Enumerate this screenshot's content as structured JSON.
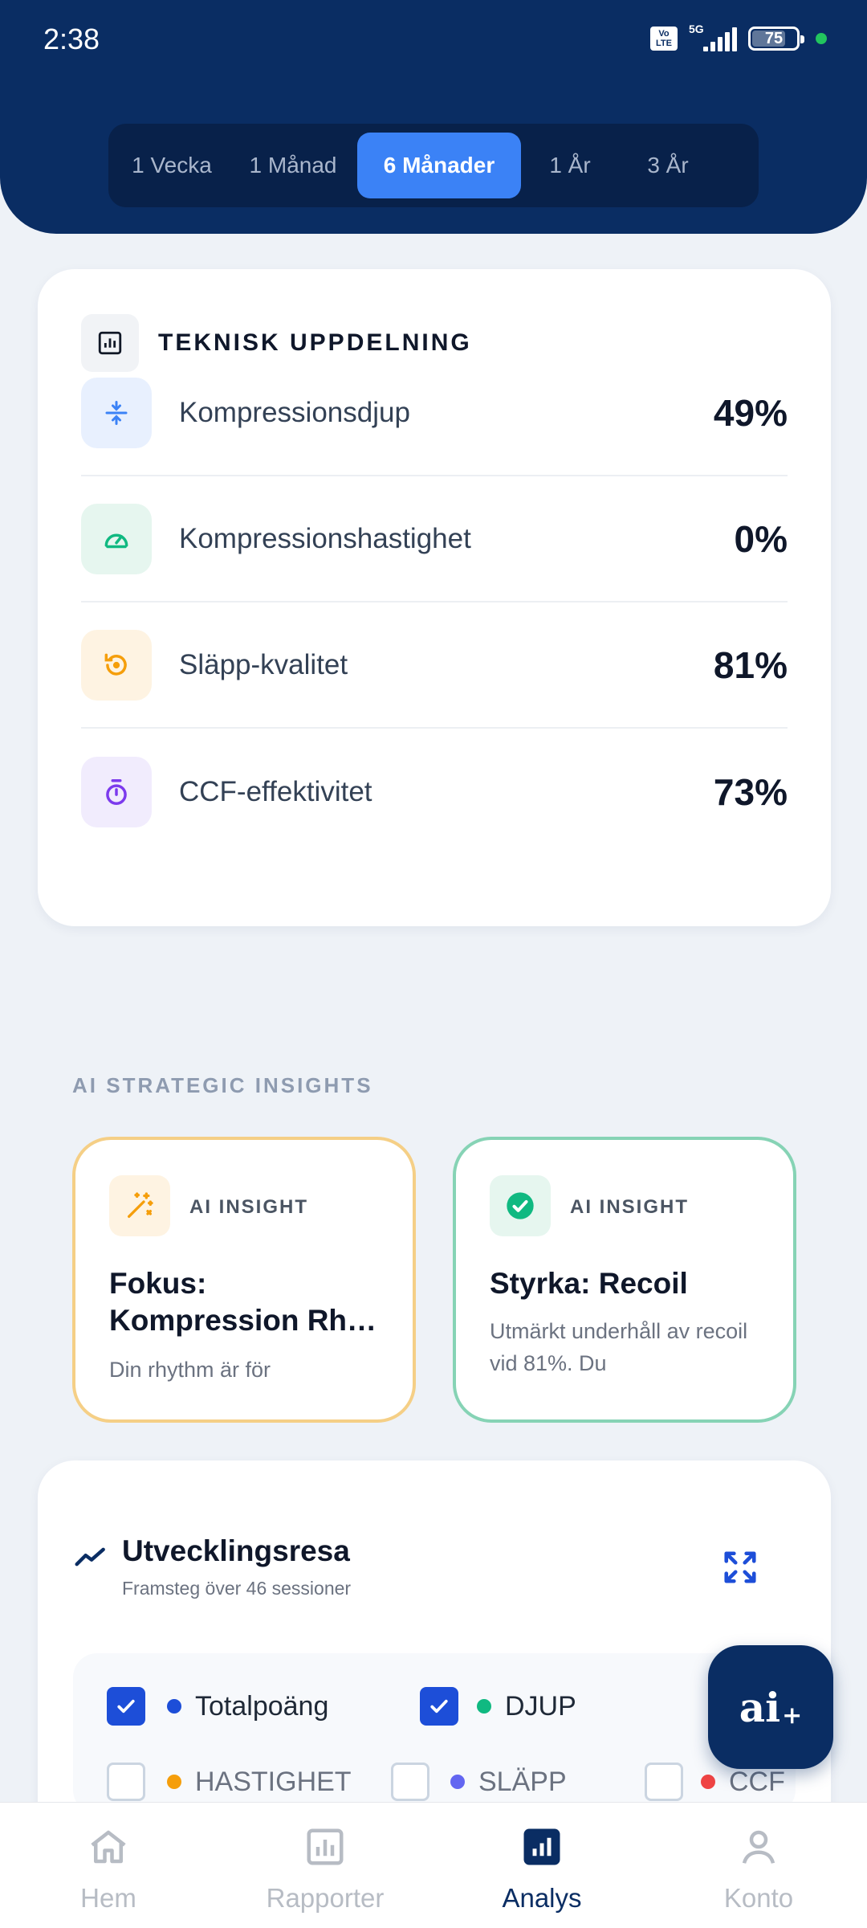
{
  "status_bar": {
    "time": "2:38",
    "volte": "Vo LTE",
    "network": "5G",
    "battery": "75"
  },
  "range_tabs": [
    {
      "label": "1 Vecka",
      "active": false
    },
    {
      "label": "1 Månad",
      "active": false
    },
    {
      "label": "6 Månader",
      "active": true
    },
    {
      "label": "1 År",
      "active": false
    },
    {
      "label": "3 År",
      "active": false
    }
  ],
  "technical": {
    "title": "TEKNISK UPPDELNING",
    "metrics": [
      {
        "label": "Kompressionsdjup",
        "value": "49%",
        "icon": "compress-icon"
      },
      {
        "label": "Kompressionshastighet",
        "value": "0%",
        "icon": "speedometer-icon"
      },
      {
        "label": "Släpp-kvalitet",
        "value": "81%",
        "icon": "recoil-icon"
      },
      {
        "label": "CCF-effektivitet",
        "value": "73%",
        "icon": "timer-icon"
      }
    ]
  },
  "insights": {
    "section_label": "AI STRATEGIC INSIGHTS",
    "cards": [
      {
        "tag": "AI INSIGHT",
        "title_line1": "Fokus:",
        "title_line2": "Kompression Rhythm",
        "desc": "Din rhythm är för",
        "icon": "magic-wand-icon"
      },
      {
        "tag": "AI INSIGHT",
        "title_line1": "Styrka: Recoil",
        "desc": "Utmärkt underhåll av recoil vid 81%. Du",
        "icon": "check-circle-icon"
      }
    ]
  },
  "journey": {
    "title": "Utvecklingsresa",
    "subtitle": "Framsteg över 46 sessioner",
    "legend": [
      {
        "label": "Totalpoäng",
        "checked": true,
        "color": "#1d4ed8"
      },
      {
        "label": "DJUP",
        "checked": true,
        "color": "#10b981"
      },
      {
        "label": "HASTIGHET",
        "checked": false,
        "color": "#f59e0b"
      },
      {
        "label": "SLÄPP",
        "checked": false,
        "color": "#6366f1"
      },
      {
        "label": "CCF",
        "checked": false,
        "color": "#ef4444"
      }
    ]
  },
  "fab": {
    "label": "ai",
    "suffix": "+"
  },
  "bottom_nav": [
    {
      "label": "Hem",
      "icon": "home-icon",
      "active": false
    },
    {
      "label": "Rapporter",
      "icon": "reports-icon",
      "active": false
    },
    {
      "label": "Analys",
      "icon": "analytics-icon",
      "active": true
    },
    {
      "label": "Konto",
      "icon": "account-icon",
      "active": false
    }
  ],
  "colors": {
    "header": "#0a2d63",
    "accent": "#3b82f6",
    "background": "#eef2f7"
  }
}
